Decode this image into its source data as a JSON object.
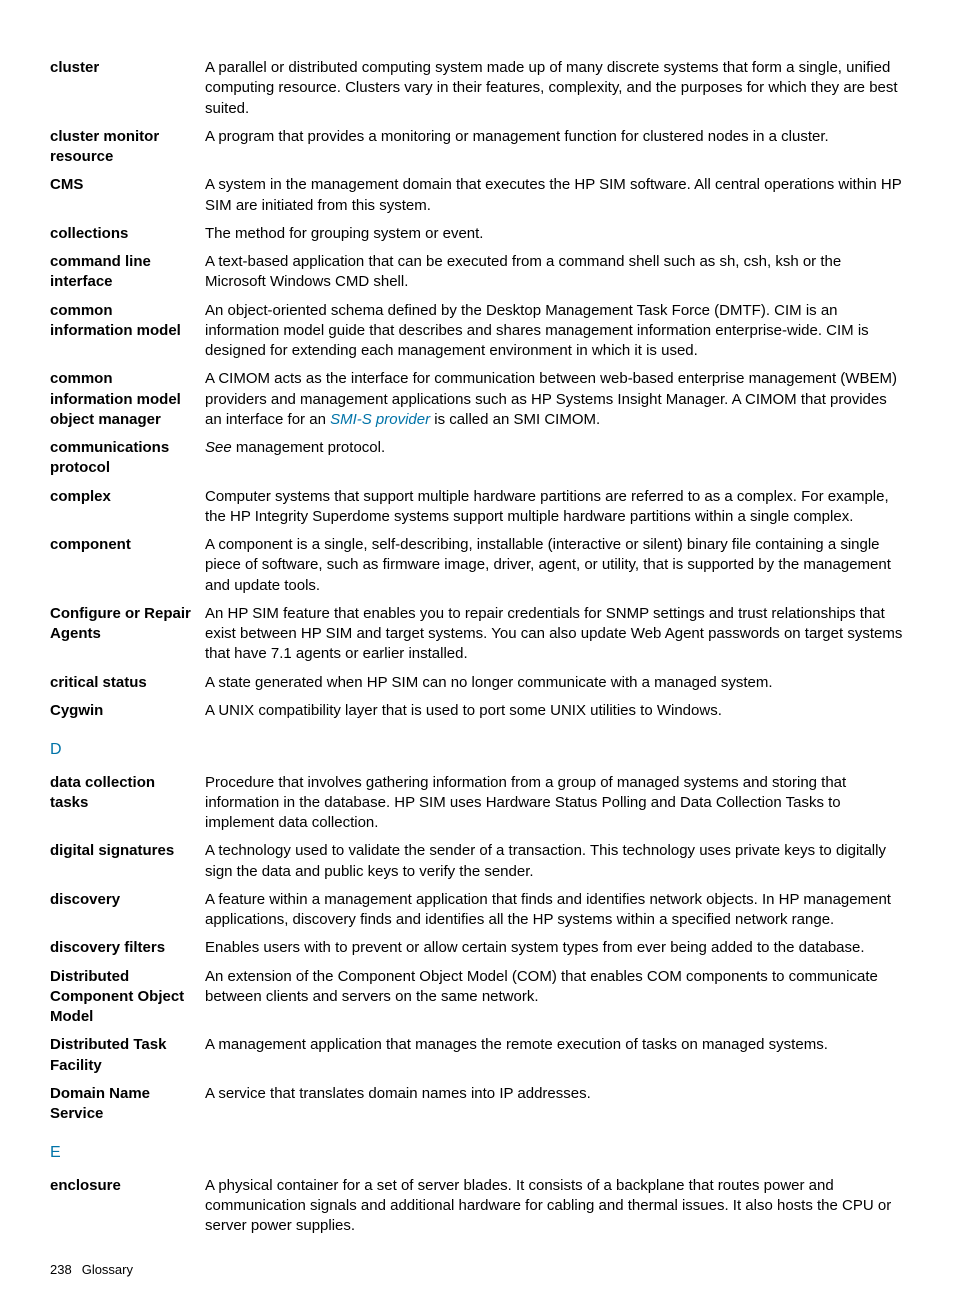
{
  "entries_block1": [
    {
      "term": "cluster",
      "def": "A parallel or distributed computing system made up of many discrete systems that form a single, unified computing resource. Clusters vary in their features, complexity, and the purposes for which they are best suited."
    },
    {
      "term": "cluster monitor resource",
      "def": "A program that provides a monitoring or management function for clustered nodes in a cluster."
    },
    {
      "term": "CMS",
      "def": "A system in the management domain that executes the HP SIM software. All central operations within HP SIM are initiated from this system."
    },
    {
      "term": "collections",
      "def": "The method for grouping system or event."
    },
    {
      "term": "command line interface",
      "def": "A text-based application that can be executed from a command shell such as sh, csh, ksh or the Microsoft Windows CMD shell."
    },
    {
      "term": "common information model",
      "def": "An object-oriented schema defined by the Desktop Management Task Force (DMTF). CIM is an information model guide that describes and shares management information enterprise-wide. CIM is designed for extending each management environment in which it is used."
    },
    {
      "term": "common information model object manager",
      "def_pre": "A CIMOM acts as the interface for communication between web-based enterprise management (WBEM) providers and management applications such as HP Systems Insight Manager. A CIMOM that provides an interface for an ",
      "link": "SMI-S provider",
      "def_post": " is called an SMI CIMOM."
    },
    {
      "term": "communications protocol",
      "italic_pre": "See",
      "def_post": " management protocol."
    },
    {
      "term": "complex",
      "def": "Computer systems that support multiple hardware partitions are referred to as a complex. For example, the HP Integrity Superdome systems support multiple hardware partitions within a single complex."
    },
    {
      "term": "component",
      "def": "A component is a single, self-describing, installable (interactive or silent) binary file containing a single piece of software, such as firmware image, driver, agent, or utility, that is supported by the management and update tools."
    },
    {
      "term": "Configure or Repair Agents",
      "def": "An HP SIM feature that enables you to repair credentials for SNMP settings and trust relationships that exist between HP SIM and target systems. You can also update Web Agent passwords on target systems that have 7.1 agents or earlier installed."
    },
    {
      "term": "critical status",
      "def": "A state generated when HP SIM can no longer communicate with a managed system."
    },
    {
      "term": "Cygwin",
      "def": "A UNIX compatibility layer that is used to port some UNIX utilities to Windows."
    }
  ],
  "section_d": "D",
  "entries_block2": [
    {
      "term": "data collection tasks",
      "def": "Procedure that involves gathering information from a group of managed systems and storing that information in the database. HP SIM uses Hardware Status Polling and Data Collection Tasks to implement data collection."
    },
    {
      "term": "digital signatures",
      "def": "A technology used to validate the sender of a transaction. This technology uses private keys to digitally sign the data and public keys to verify the sender."
    },
    {
      "term": "discovery",
      "def": "A feature within a management application that finds and identifies network objects. In HP management applications, discovery finds and identifies all the HP systems within a specified network range."
    },
    {
      "term": "discovery filters",
      "def": "Enables users with to prevent or allow certain system types from ever being added to the database."
    },
    {
      "term": "Distributed Component Object Model",
      "def": "An extension of the Component Object Model (COM) that enables COM components to communicate between clients and servers on the same network."
    },
    {
      "term": "Distributed Task Facility",
      "def": "A management application that manages the remote execution of tasks on managed systems."
    },
    {
      "term": "Domain Name Service",
      "def": "A service that translates domain names into IP addresses."
    }
  ],
  "section_e": "E",
  "entries_block3": [
    {
      "term": "enclosure",
      "def": "A physical container for a set of server blades. It consists of a backplane that routes power and communication signals and additional hardware for cabling and thermal issues. It also hosts the CPU or server power supplies."
    }
  ],
  "footer": {
    "page": "238",
    "label": "Glossary"
  }
}
